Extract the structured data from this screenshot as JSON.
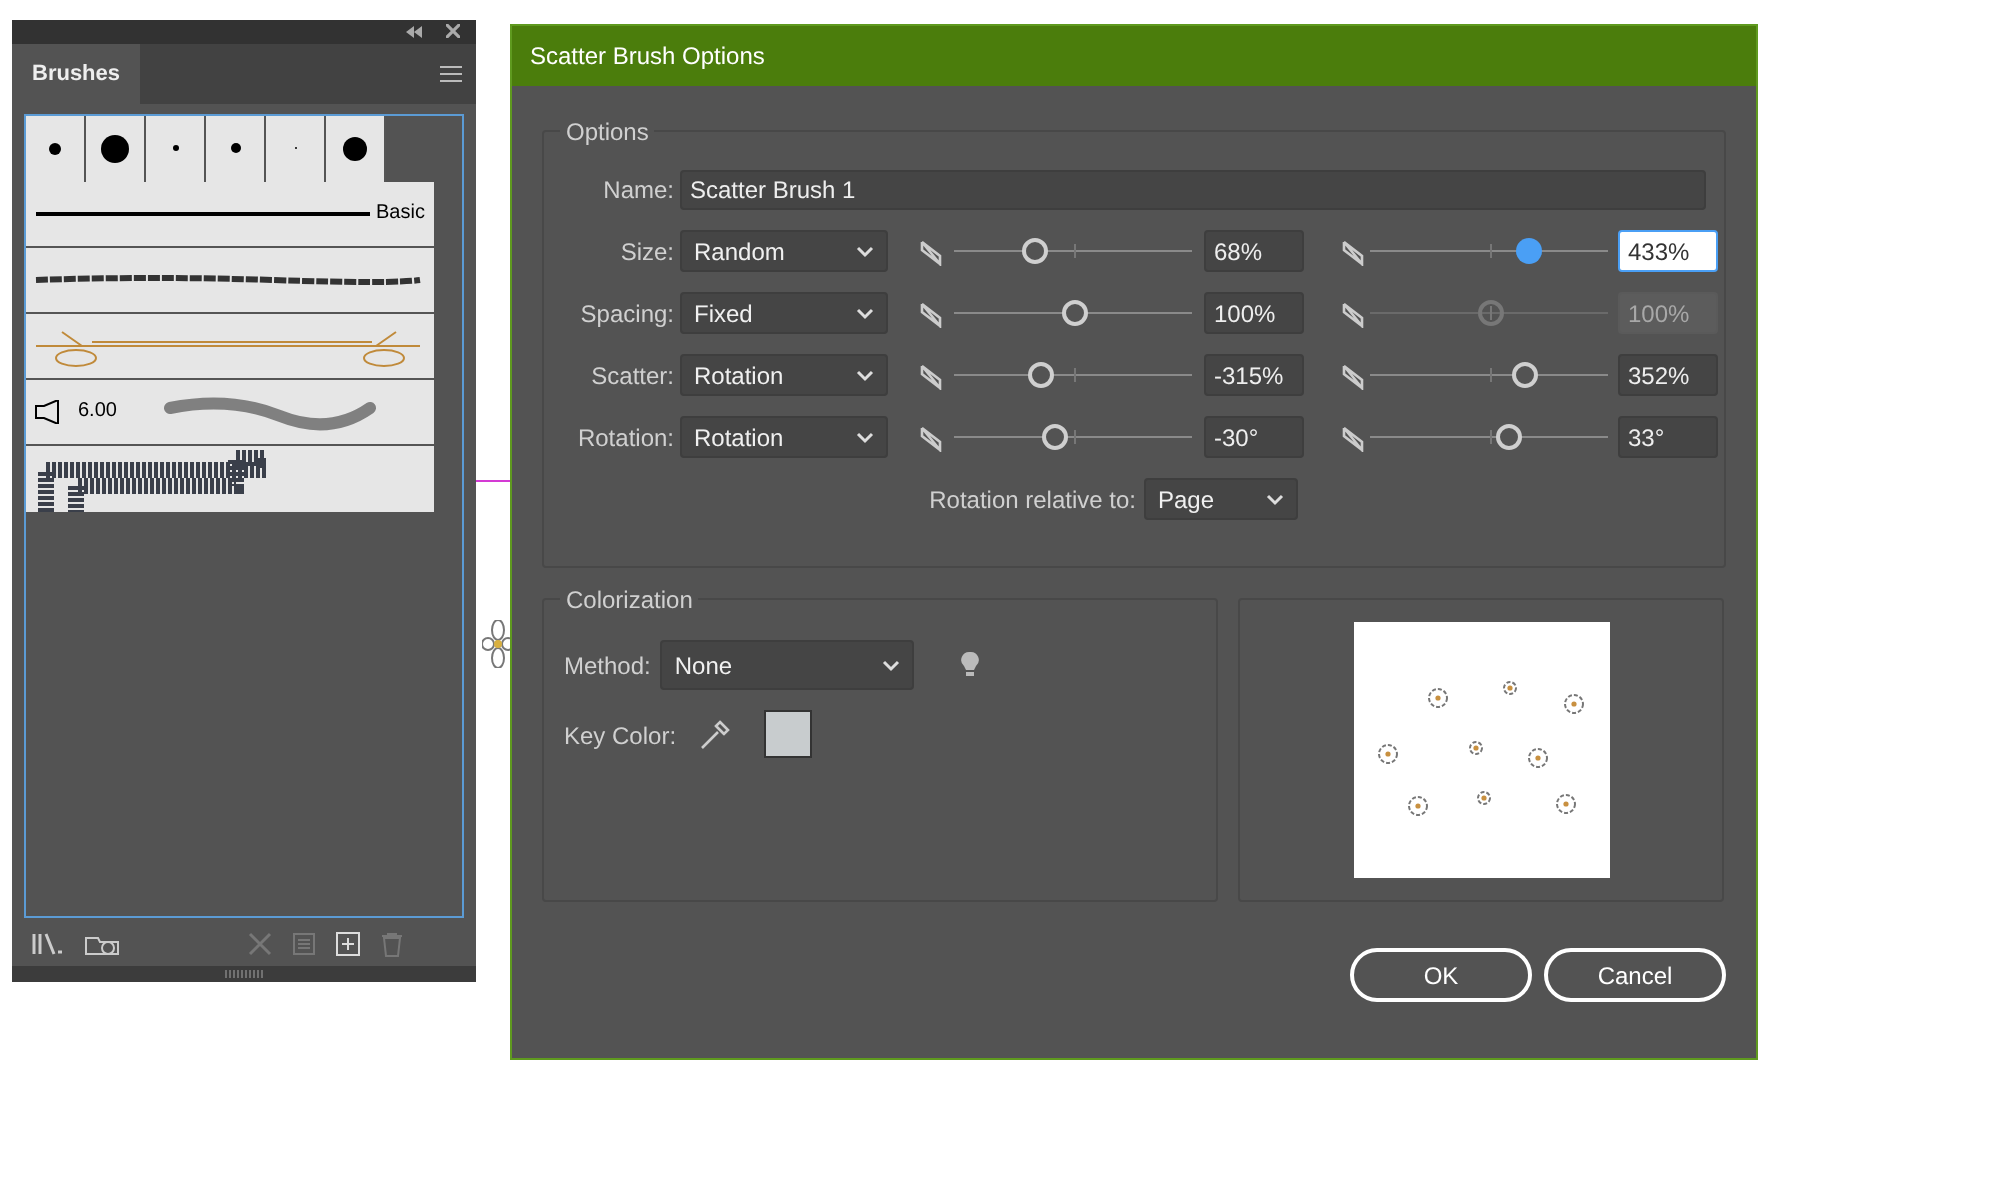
{
  "brushes_panel": {
    "tab": "Brushes",
    "rows": [
      {
        "kind": "dots"
      },
      {
        "kind": "line",
        "label": "Basic"
      },
      {
        "kind": "charcoal"
      },
      {
        "kind": "art"
      },
      {
        "kind": "bristle",
        "label": "6.00"
      },
      {
        "kind": "pattern"
      }
    ]
  },
  "dialog": {
    "title": "Scatter Brush Options",
    "options_group": "Options",
    "name_label": "Name:",
    "name_value": "Scatter Brush 1",
    "params": [
      {
        "label": "Size:",
        "method": "Random",
        "min": {
          "level": 0.34,
          "value": "68%"
        },
        "max": {
          "level": 0.66,
          "value": "433%",
          "disabled": false,
          "focused": true
        }
      },
      {
        "label": "Spacing:",
        "method": "Fixed",
        "min": {
          "level": 0.5,
          "value": "100%"
        },
        "max": {
          "level": 0.5,
          "value": "100%",
          "disabled": true,
          "focused": false
        }
      },
      {
        "label": "Scatter:",
        "method": "Rotation",
        "min": {
          "level": 0.36,
          "value": "-315%"
        },
        "max": {
          "level": 0.65,
          "value": "352%",
          "disabled": false,
          "focused": false
        }
      },
      {
        "label": "Rotation:",
        "method": "Rotation",
        "min": {
          "level": 0.42,
          "value": "-30°"
        },
        "max": {
          "level": 0.58,
          "value": "33°",
          "disabled": false,
          "focused": false
        }
      }
    ],
    "rotation_relative_label": "Rotation relative to:",
    "rotation_relative_value": "Page",
    "colorization_group": "Colorization",
    "method_label": "Method:",
    "method_value": "None",
    "key_color_label": "Key Color:",
    "buttons": [
      "OK",
      "Cancel"
    ]
  }
}
